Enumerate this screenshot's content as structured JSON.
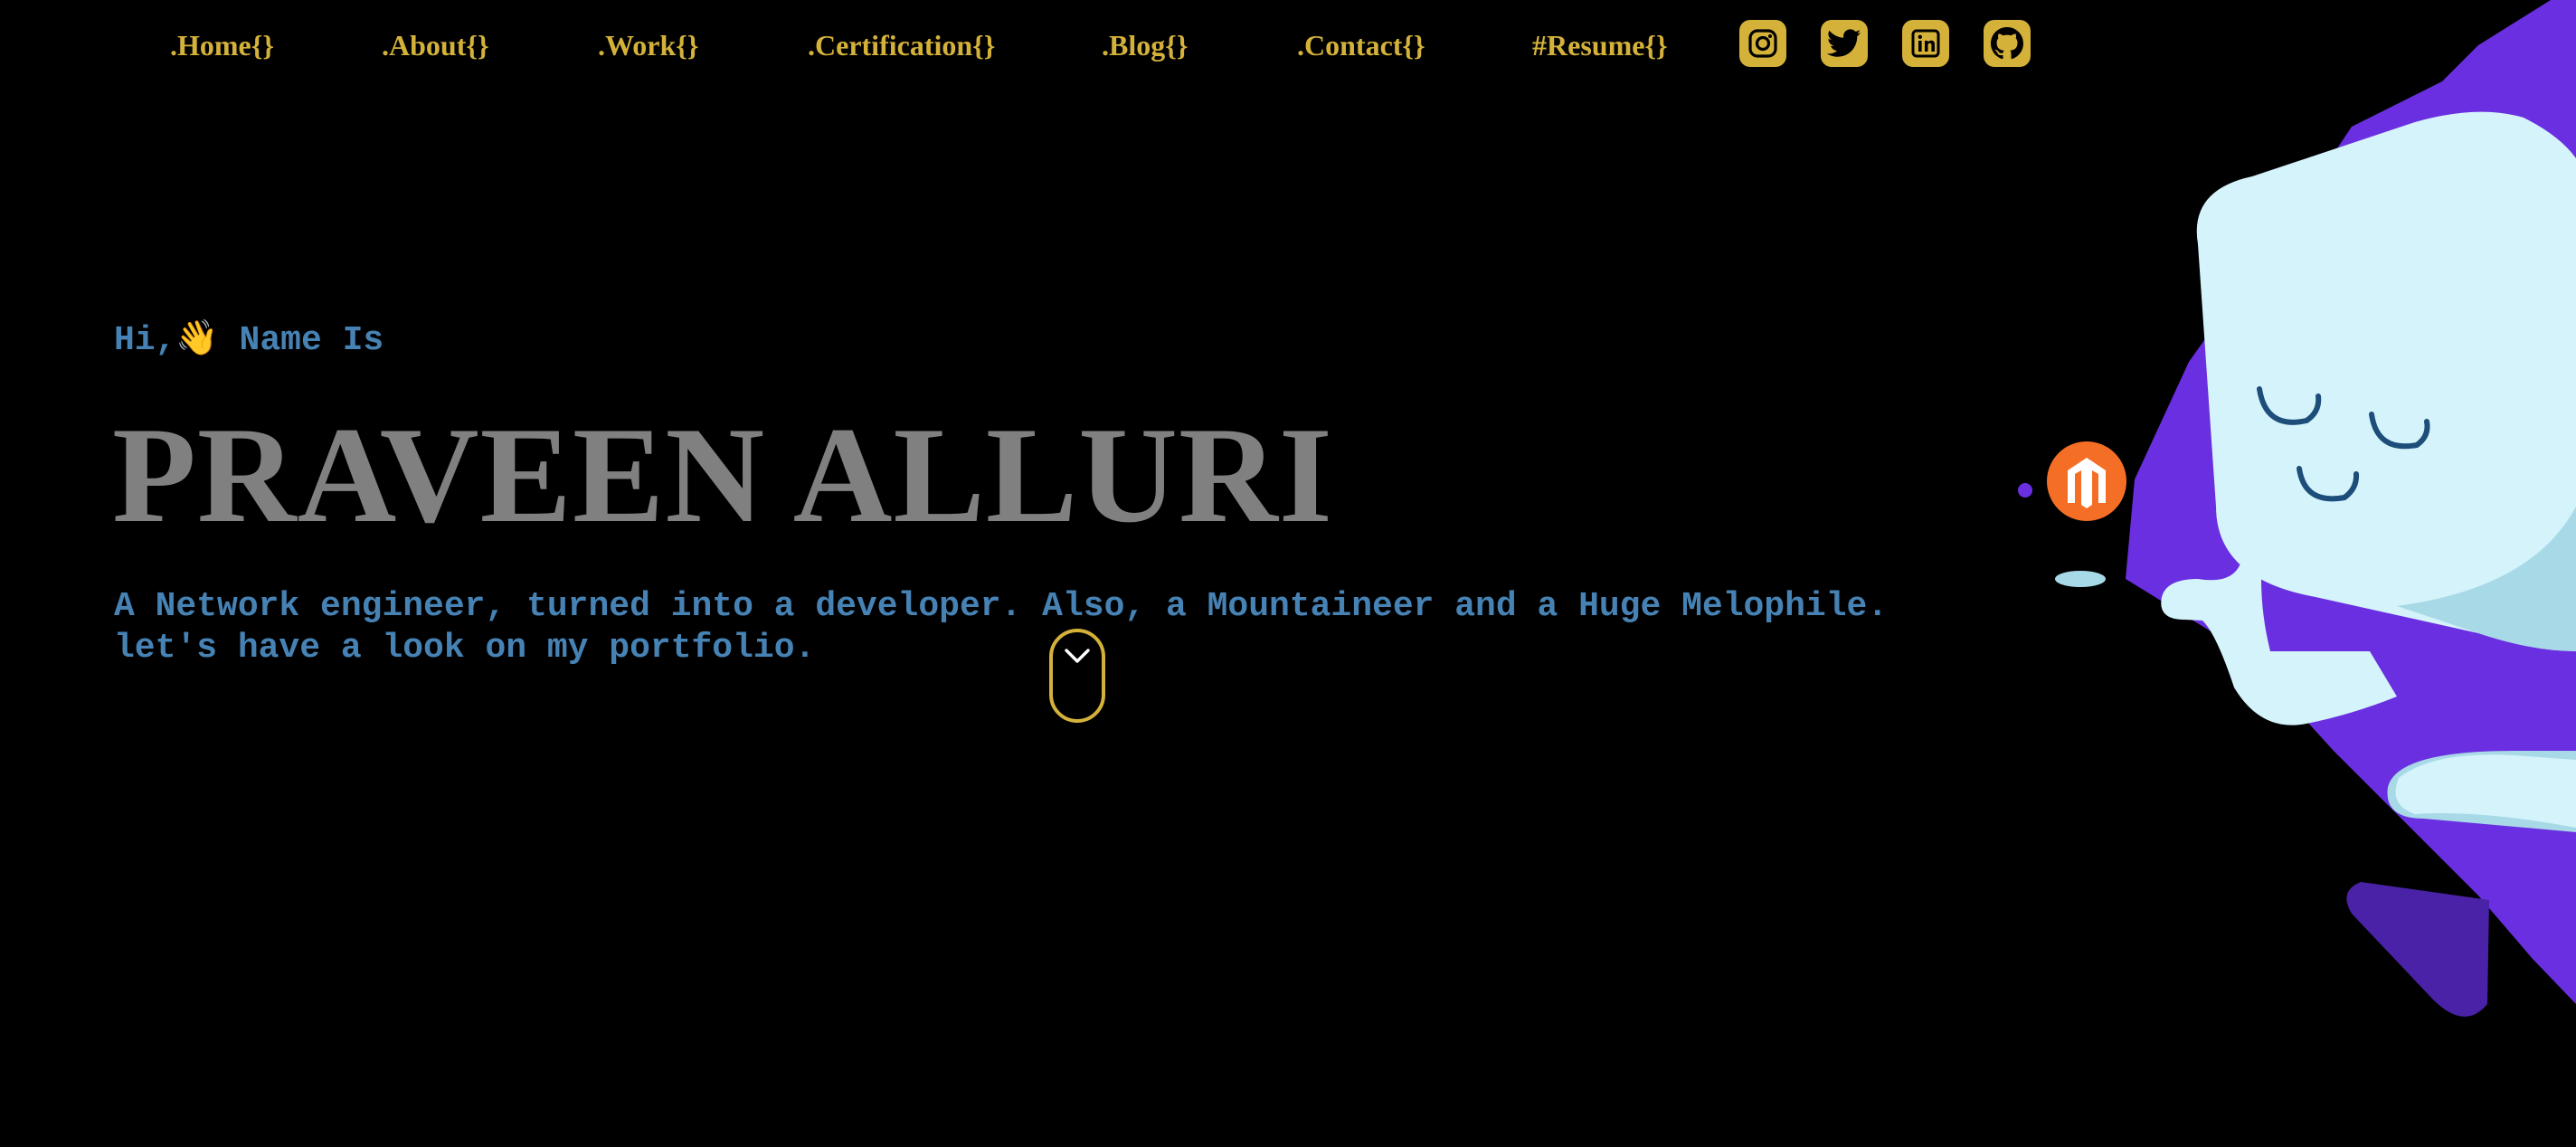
{
  "nav": {
    "items": [
      {
        "label": ".Home{}"
      },
      {
        "label": ".About{}"
      },
      {
        "label": ".Work{}"
      },
      {
        "label": ".Certification{}"
      },
      {
        "label": ".Blog{}"
      },
      {
        "label": ".Contact{}"
      },
      {
        "label": "#Resume{}"
      }
    ],
    "social_icons": [
      "instagram-icon",
      "twitter-icon",
      "linkedin-icon",
      "github-icon"
    ]
  },
  "hero": {
    "greeting_prefix": "Hi,",
    "greeting_emoji": "👋",
    "greeting_suffix": " Name Is",
    "name": "PRAVEEN ALLURI",
    "tagline_line1": "A Network engineer, turned into a developer. Also, a Mountaineer and a Huge Melophile.",
    "tagline_line2": "let's have a look on my portfolio."
  },
  "colors": {
    "background": "#000000",
    "nav_accent": "#d4b23a",
    "text_blue": "#4682b4",
    "name_gray": "#808080",
    "illustration_purple": "#6a2fe0",
    "illustration_cyan": "#d4f3fb",
    "badge_orange": "#f46f25"
  },
  "icons": {
    "scroll": "chevron-down-icon",
    "illustration": "mascot-illustration",
    "badge": "magento-logo"
  }
}
